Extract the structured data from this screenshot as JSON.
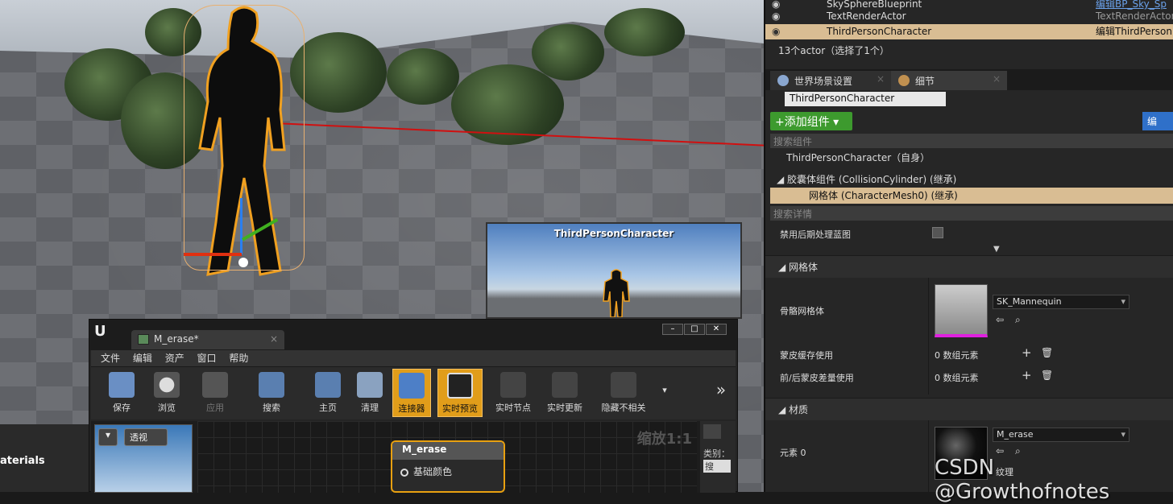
{
  "viewport": {
    "preview_title": "ThirdPersonCharacter",
    "left_strip_label": "aterials"
  },
  "material_editor": {
    "tab_title": "M_erase*",
    "menu": [
      "文件",
      "编辑",
      "资产",
      "窗口",
      "帮助"
    ],
    "toolbar": [
      {
        "label": "保存",
        "icon": "save-icon",
        "active": false
      },
      {
        "label": "浏览",
        "icon": "browse-icon",
        "active": false
      },
      {
        "label": "应用",
        "icon": "apply-icon",
        "active": false
      },
      {
        "label": "搜索",
        "icon": "search-icon",
        "active": false
      },
      {
        "label": "主页",
        "icon": "home-icon",
        "active": false
      },
      {
        "label": "清理",
        "icon": "clean-icon",
        "active": false
      },
      {
        "label": "连接器",
        "icon": "connector-icon",
        "active": true
      },
      {
        "label": "实时预览",
        "icon": "live-preview-icon",
        "active": true
      },
      {
        "label": "实时节点",
        "icon": "live-nodes-icon",
        "active": false
      },
      {
        "label": "实时更新",
        "icon": "live-update-icon",
        "active": false
      },
      {
        "label": "隐藏不相关",
        "icon": "hide-unrelated-icon",
        "active": false
      }
    ],
    "viewport_mode": "透视",
    "zoom": "缩放1:1",
    "node_title": "M_erase",
    "node_pin": "基础颜色",
    "palette_label": "类别：",
    "palette_search": "搜"
  },
  "outliner": {
    "rows": [
      {
        "name": "SkySphereBlueprint",
        "type": "编辑BP_Sky_Sp",
        "selected": false
      },
      {
        "name": "TextRenderActor",
        "type": "TextRenderActor",
        "selected": false
      },
      {
        "name": "ThirdPersonCharacter",
        "type": "编辑ThirdPerson",
        "selected": true
      }
    ],
    "actor_count": "13个actor（选择了1个）"
  },
  "details": {
    "tabs": [
      {
        "label": "世界场景设置"
      },
      {
        "label": "细节"
      }
    ],
    "actor_name": "ThirdPersonCharacter",
    "add_component": "+添加组件 ▾",
    "bp_button": "编",
    "search_components": "搜索组件",
    "components": [
      {
        "label": "ThirdPersonCharacter（自身）",
        "selected": false
      },
      {
        "label": "◢ 胶囊体组件 (CollisionCylinder) (继承)",
        "selected": false
      },
      {
        "label": "网格体 (CharacterMesh0) (继承)",
        "selected": true
      }
    ],
    "search_details": "搜索详情",
    "disable_postprocess": "禁用后期处理蓝图",
    "section_mesh": "◢ 网格体",
    "skeletal_mesh_label": "骨骼网格体",
    "skeletal_mesh_value": "SK_Mannequin",
    "skin_cache_label": "蒙皮缓存使用",
    "skin_cache_value": "0 数组元素",
    "morph_label": "前/后蒙皮差量使用",
    "morph_value": "0 数组元素",
    "section_material": "◢ 材质",
    "element0_label": "元素 0",
    "element0_value": "M_erase",
    "texture_label": "纹理"
  },
  "watermark": "CSDN @Growthofnotes",
  "colors": {
    "selection": "#d9bd93",
    "accent_orange": "#e19d1a",
    "add_green": "#3d9a2e",
    "blue_button": "#2f70c9"
  }
}
